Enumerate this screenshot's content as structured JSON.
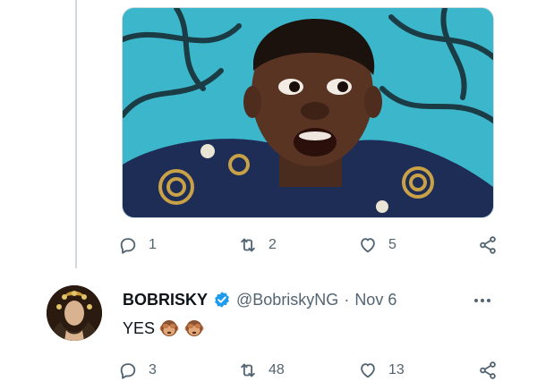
{
  "previous_tweet": {
    "media": {
      "description_icon": "photo-icon"
    },
    "actions": {
      "reply_count": "1",
      "retweet_count": "2",
      "like_count": "5"
    }
  },
  "reply_tweet": {
    "author": {
      "name": "BOBRISKY",
      "handle": "@BobriskyNG",
      "separator": "·",
      "date": "Nov 6",
      "verified": true
    },
    "text": "YES",
    "emoji": [
      "see-no-evil-monkey",
      "see-no-evil-monkey"
    ],
    "actions": {
      "reply_count": "3",
      "retweet_count": "48",
      "like_count": "13"
    }
  },
  "colors": {
    "text_primary": "#0f1419",
    "text_secondary": "#536471",
    "verified_blue": "#1d9bf0",
    "thread_line": "#cfd9de"
  }
}
